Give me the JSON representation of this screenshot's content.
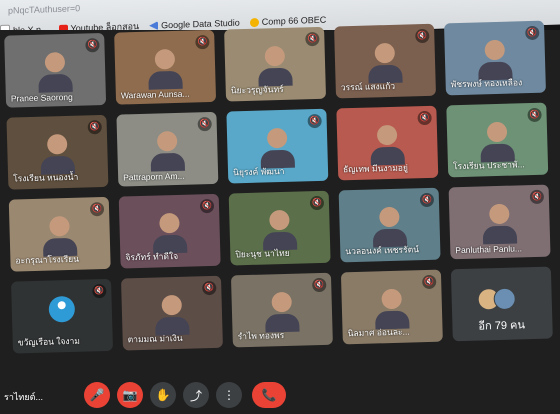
{
  "browser": {
    "url_fragment": "pNqcTAuthuser=0",
    "bookmarks": [
      {
        "label": "ble X.n...",
        "icon": "page-icon"
      },
      {
        "label": "Youtube ล็อกสอน",
        "icon": "youtube-icon"
      },
      {
        "label": "Google Data Studio",
        "icon": "google-data-studio-icon"
      },
      {
        "label": "Comp 66 OBEC",
        "icon": "comp-icon"
      }
    ]
  },
  "participants": [
    {
      "name": "Pranee Saorong",
      "bg": "#6f6f6f"
    },
    {
      "name": "Warawan Aunsa...",
      "bg": "#8f6c4e"
    },
    {
      "name": "นิยะวรุญจันทร์",
      "bg": "#9a8b72"
    },
    {
      "name": "วรรณ์ แสงแก้ว",
      "bg": "#7b5f4f"
    },
    {
      "name": "พัชรพงษ์ ทองเหลือง",
      "bg": "#6f8aa0"
    },
    {
      "name": "โรงเรียน หนองน้ำ",
      "bg": "#5f4f3e"
    },
    {
      "name": "Pattraporn Am...",
      "bg": "#8d8d86"
    },
    {
      "name": "นิยุรงค์ พัฒนา",
      "bg": "#59a8c9"
    },
    {
      "name": "ธัญเทพ มีนงามอยู่",
      "bg": "#b85a4f"
    },
    {
      "name": "โรงเรียน ประชาพั...",
      "bg": "#6e9276"
    },
    {
      "name": "อะกรุณาโรงเรียน",
      "bg": "#9b8870"
    },
    {
      "name": "จิรภัทร์ ทำดีใจ",
      "bg": "#6b4f5b"
    },
    {
      "name": "ปิยะนุช นาไทย",
      "bg": "#5b6f4a"
    },
    {
      "name": "นวลอนงค์ เพชรรัตน์",
      "bg": "#5f7f8a"
    },
    {
      "name": "Panluthai Panlu...",
      "bg": "#7f6f73"
    },
    {
      "name": "ขวัญเรือน ใจงาม",
      "bg": "#303334"
    },
    {
      "name": "ตามมณ ม่าเงิน",
      "bg": "#5d4d47"
    },
    {
      "name": "รำไพ ทองพร",
      "bg": "#7a7264"
    },
    {
      "name": "นิลมาศ อ่อนละ...",
      "bg": "#8a7b67"
    }
  ],
  "more_tile": {
    "label": "อีก 79 คน"
  },
  "left_partial_text": "ราไทยต์...",
  "controls": {
    "mic_label": "🎤",
    "camera_label": "📷",
    "hand_label": "✋",
    "present_label": "⤴",
    "more_label": "⋮",
    "end_label": "📞"
  }
}
